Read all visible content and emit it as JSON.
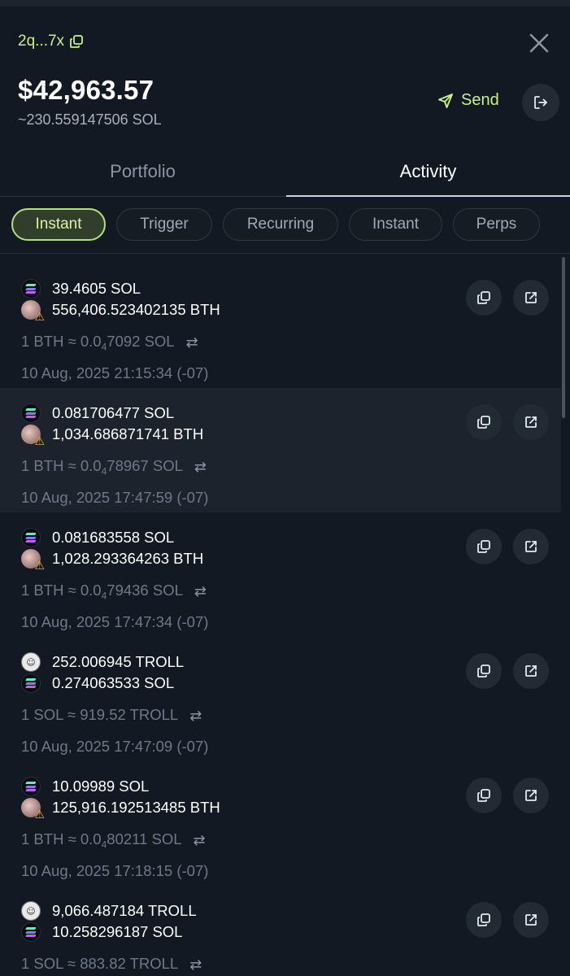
{
  "header": {
    "wallet_short": "2q...7x",
    "balance_usd": "$42,963.57",
    "balance_sol": "~230.559147506 SOL",
    "send_label": "Send"
  },
  "tabs": [
    {
      "label": "Portfolio",
      "active": false
    },
    {
      "label": "Activity",
      "active": true
    }
  ],
  "filters": [
    {
      "label": "Instant",
      "active": true
    },
    {
      "label": "Trigger",
      "active": false
    },
    {
      "label": "Recurring",
      "active": false
    },
    {
      "label": "Instant",
      "active": false
    },
    {
      "label": "Perps",
      "active": false
    }
  ],
  "activity": [
    {
      "line1": "39.4605 SOL",
      "icon1": "sol-icon",
      "line2": "556,406.523402135 BTH",
      "icon2": "bth-icon",
      "rate_prefix": "1 BTH ≈ 0.0",
      "rate_sub": "4",
      "rate_suffix": "7092 SOL",
      "timestamp": "10 Aug, 2025 21:15:34 (-07)"
    },
    {
      "line1": "0.081706477 SOL",
      "icon1": "sol-icon",
      "line2": "1,034.686871741 BTH",
      "icon2": "bth-icon",
      "rate_prefix": "1 BTH ≈ 0.0",
      "rate_sub": "4",
      "rate_suffix": "78967 SOL",
      "timestamp": "10 Aug, 2025 17:47:59 (-07)"
    },
    {
      "line1": "0.081683558 SOL",
      "icon1": "sol-icon",
      "line2": "1,028.293364263 BTH",
      "icon2": "bth-icon",
      "rate_prefix": "1 BTH ≈ 0.0",
      "rate_sub": "4",
      "rate_suffix": "79436 SOL",
      "timestamp": "10 Aug, 2025 17:47:34 (-07)"
    },
    {
      "line1": "252.006945 TROLL",
      "icon1": "troll-icon",
      "line2": "0.274063533 SOL",
      "icon2": "sol-icon",
      "rate_prefix": "1 SOL ≈ 919.52 TROLL",
      "rate_sub": "",
      "rate_suffix": "",
      "timestamp": "10 Aug, 2025 17:47:09 (-07)"
    },
    {
      "line1": "10.09989 SOL",
      "icon1": "sol-icon",
      "line2": "125,916.192513485 BTH",
      "icon2": "bth-icon",
      "rate_prefix": "1 BTH ≈ 0.0",
      "rate_sub": "4",
      "rate_suffix": "80211 SOL",
      "timestamp": "10 Aug, 2025 17:18:15 (-07)"
    },
    {
      "line1": "9,066.487184 TROLL",
      "icon1": "troll-icon",
      "line2": "10.258296187 SOL",
      "icon2": "sol-icon",
      "rate_prefix": "1 SOL ≈ 883.82 TROLL",
      "rate_sub": "",
      "rate_suffix": "",
      "timestamp": ""
    }
  ],
  "colors": {
    "accent": "#c7f284",
    "background": "#131922",
    "muted": "#6e7988"
  }
}
